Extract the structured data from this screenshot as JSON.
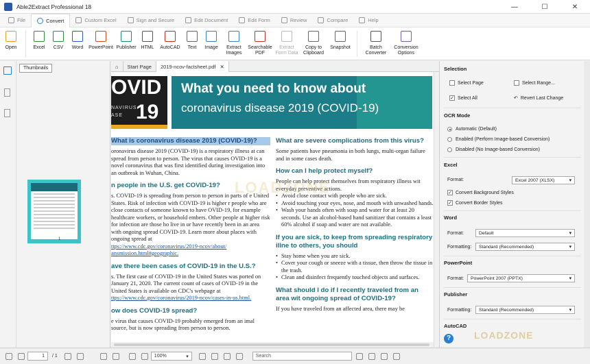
{
  "window": {
    "title": "Able2Extract Professional 18",
    "min": "—",
    "max": "☐",
    "close": "✕"
  },
  "menu": {
    "tabs": [
      {
        "label": "File",
        "active": false
      },
      {
        "label": "Convert",
        "active": true
      },
      {
        "label": "Custom Excel",
        "active": false
      },
      {
        "label": "Sign and Secure",
        "active": false
      },
      {
        "label": "Edit Document",
        "active": false
      },
      {
        "label": "Edit Form",
        "active": false
      },
      {
        "label": "Review",
        "active": false
      },
      {
        "label": "Compare",
        "active": false
      },
      {
        "label": "Help",
        "active": false
      }
    ]
  },
  "ribbon": {
    "buttons": [
      {
        "label": "Open",
        "icon": "folder-icon",
        "color": "#e0a020"
      },
      {
        "label": "Excel",
        "icon": "excel-icon",
        "color": "#2e8b3d"
      },
      {
        "label": "CSV",
        "icon": "csv-icon",
        "color": "#2e8b3d"
      },
      {
        "label": "Word",
        "icon": "word-icon",
        "color": "#2b5fb5"
      },
      {
        "label": "PowerPoint",
        "icon": "powerpoint-icon",
        "color": "#d04a22"
      },
      {
        "label": "Publisher",
        "icon": "publisher-icon",
        "color": "#1a8a7a"
      },
      {
        "label": "HTML",
        "icon": "html-icon",
        "color": "#555555"
      },
      {
        "label": "AutoCAD",
        "icon": "autocad-icon",
        "color": "#c0302a"
      },
      {
        "label": "Text",
        "icon": "text-icon",
        "color": "#666666"
      },
      {
        "label": "Image",
        "icon": "image-icon",
        "color": "#3a7fc0"
      },
      {
        "label": "Extract\nImages",
        "icon": "extract-images-icon",
        "color": "#3a7fc0"
      },
      {
        "label": "Searchable\nPDF",
        "icon": "searchable-pdf-icon",
        "color": "#c0302a"
      },
      {
        "label": "Extract\nForm Data",
        "icon": "extract-form-icon",
        "color": "#bbbbbb",
        "disabled": true
      },
      {
        "label": "Copy to\nClipboard",
        "icon": "clipboard-icon",
        "color": "#666666"
      },
      {
        "label": "Snapshot",
        "icon": "camera-icon",
        "color": "#666666"
      },
      {
        "label": "Batch\nConverter",
        "icon": "batch-icon",
        "color": "#555555"
      },
      {
        "label": "Conversion\nOptions",
        "icon": "gear-icon",
        "color": "#7a5fb0"
      }
    ]
  },
  "thumbnails": {
    "tab_label": "Thumbnails",
    "page_number": "1"
  },
  "doc_tabs": [
    {
      "label": "Start Page",
      "active": false
    },
    {
      "label": "2019-ncov-factsheet.pdf",
      "active": true,
      "close": "✕"
    }
  ],
  "document": {
    "banner": {
      "left_big": "OVID",
      "left_big2": "19",
      "left_small": "NAVIRUS",
      "left_small2": "ASE",
      "title_line1": "What you need to know about",
      "title_line2": "coronavirus disease 2019 (COVID-19)"
    },
    "left_col": [
      {
        "type": "h",
        "text": "What is coronavirus disease 2019 (COVID-19)?",
        "selected": true
      },
      {
        "type": "p",
        "text": "oronavirus disease 2019 (COVID-19) is a respiratory illness at can spread from person to person. The virus that causes OVID-19 is a novel coronavirus that was first identified during investigation into an outbreak in Wuhan, China."
      },
      {
        "type": "h",
        "text": "n people in the U.S. get COVID-19?"
      },
      {
        "type": "p",
        "text": "s. COVID-19 is spreading from person to person in parts of e United States. Risk of infection with COVID-19 is higher r people who are close contacts of someone known to have OVID-19, for example healthcare workers, or household embers. Other people at higher risk for infection are those ho live in or have recently been in an area with ongoing spread COVID-19. Learn more about places with ongoing spread at"
      },
      {
        "type": "link",
        "text": "ttps://www.cdc.gov/coronavirus/2019-ncov/about/ ansmission.html#geographic."
      },
      {
        "type": "h",
        "text": "ave there been cases of COVID-19 in the U.S.?"
      },
      {
        "type": "p",
        "text": "s. The first case of COVID-19 in the United States was ported on January 21, 2020. The current count of cases of OVID-19 in the United States is available on CDC's webpage at"
      },
      {
        "type": "link",
        "text": "ttps://www.cdc.gov/coronavirus/2019-ncov/cases-in-us.html."
      },
      {
        "type": "h",
        "text": "ow does COVID-19 spread?"
      },
      {
        "type": "p",
        "text": "e virus that causes COVID-19 probably emerged from an imal source, but is now spreading from person to person."
      }
    ],
    "right_col": [
      {
        "type": "h",
        "text": "What are severe complications from this virus?"
      },
      {
        "type": "p",
        "text": "Some patients have pneumonia in both lungs, multi-organ failure and in some cases death."
      },
      {
        "type": "h",
        "text": "How can I help protect myself?"
      },
      {
        "type": "p",
        "text": "People can help protect themselves from respiratory illness wit everyday preventive actions."
      },
      {
        "type": "li",
        "text": "Avoid close contact with people who are sick."
      },
      {
        "type": "li",
        "text": "Avoid touching your eyes, nose, and mouth with unwashed hands."
      },
      {
        "type": "li",
        "text": "Wash your hands often with soap and water for at least 20 seconds. Use an alcohol-based hand sanitizer that contains a least 60% alcohol if soap and water are not available."
      },
      {
        "type": "h",
        "text": "If you are sick, to keep from spreading respiratory illne to others, you should"
      },
      {
        "type": "li",
        "text": "Stay home when you are sick."
      },
      {
        "type": "li",
        "text": "Cover your cough or sneeze with a tissue, then throw the tissue in the trash."
      },
      {
        "type": "li",
        "text": "Clean and disinfect frequently touched objects and surfaces."
      },
      {
        "type": "h",
        "text": "What should I do if I recently traveled from an area wit ongoing spread of COVID-19?"
      },
      {
        "type": "p",
        "text": "If you have traveled from an affected area, there may be"
      }
    ],
    "watermark": "LOADZONE"
  },
  "right_panel": {
    "selection": {
      "title": "Selection",
      "select_page": "Select Page",
      "select_range": "Select Range...",
      "select_all": "Select All",
      "revert": "Revert Last Change"
    },
    "ocr": {
      "title": "OCR Mode",
      "options": [
        "Automatic (Default)",
        "Enabled (Perform Image-based Conversion)",
        "Disabled (No Image-based Conversion)"
      ],
      "selected": 0
    },
    "excel": {
      "title": "Excel",
      "format_label": "Format:",
      "format_value": "Excel 2007 (XLSX)",
      "conv_bg": "Convert Background Styles",
      "conv_border": "Convert Border Styles"
    },
    "word": {
      "title": "Word",
      "format_label": "Format:",
      "format_value": "Default",
      "formatting_label": "Formatting:",
      "formatting_value": "Standard (Recommended)"
    },
    "powerpoint": {
      "title": "PowerPoint",
      "format_label": "Format:",
      "format_value": "PowerPoint 2007 (PPTX)"
    },
    "publisher": {
      "title": "Publisher",
      "formatting_label": "Formatting:",
      "formatting_value": "Standard (Recommended)"
    },
    "autocad": {
      "title": "AutoCAD"
    },
    "help": "?",
    "watermark": "LOADZONE"
  },
  "statusbar": {
    "page_value": "1",
    "page_total": "/ 1",
    "zoom": "100%",
    "search_placeholder": "Search"
  }
}
